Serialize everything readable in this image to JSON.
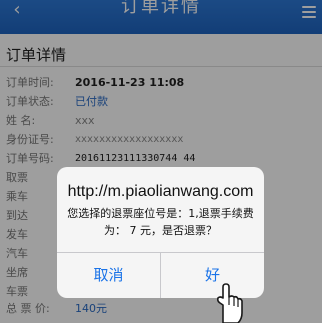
{
  "header": {
    "title": "订单详情",
    "back_icon": "chevron-left-icon",
    "menu_icon": "hamburger-menu-icon"
  },
  "order": {
    "section_title": "订单详情",
    "rows": [
      {
        "label": "订单时间:",
        "value": "2016-11-23 11:08"
      },
      {
        "label": "订单状态:",
        "value": "已付款"
      },
      {
        "label": "姓    名:",
        "value": "xxx"
      },
      {
        "label": "身份证号:",
        "value": "xxxxxxxxxxxxxxxxxx"
      },
      {
        "label": "订单号码:",
        "value": "20161123111330744 44"
      },
      {
        "label": "取票",
        "value": ""
      },
      {
        "label": "乘车",
        "value": ""
      },
      {
        "label": "到达",
        "value": ""
      },
      {
        "label": "发车",
        "value": ""
      },
      {
        "label": "汽车",
        "value": ""
      },
      {
        "label": "坐席",
        "value": ""
      },
      {
        "label": "车票",
        "value": ""
      },
      {
        "label": "总 票 价:",
        "value": "140元"
      }
    ]
  },
  "dialog": {
    "title": "http://m.piaolianwang.com",
    "message_line1": "您选择的退票座位号是：1,退票手续费",
    "message_line2": "为：  7 元，是否退票？",
    "cancel_label": "取消",
    "ok_label": "好"
  },
  "colors": {
    "navbar": "#1e64c0",
    "status_blue": "#2a6bc6",
    "dialog_button": "#1a73e8"
  }
}
